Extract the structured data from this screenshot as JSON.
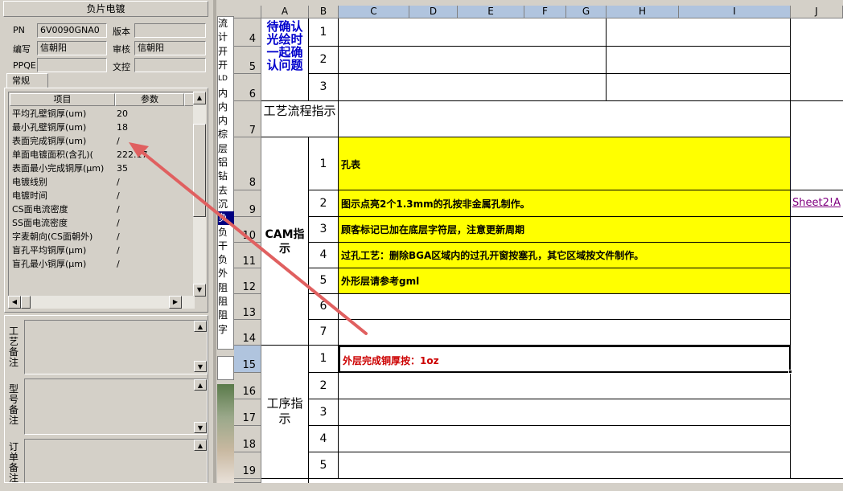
{
  "left_panel": {
    "title": "负片电镀",
    "fields": {
      "pn_label": "PN",
      "pn_value": "6V0090GNA0",
      "version_label": "版本",
      "version_value": "",
      "author_label": "编写",
      "author_value": "信朝阳",
      "reviewer_label": "审核",
      "reviewer_value": "信朝阳",
      "ppqe_label": "PPQE",
      "ppqe_value": "",
      "doc_control_label": "文控",
      "doc_control_value": ""
    },
    "tab": "常规",
    "grid": {
      "headers": [
        "项目",
        "参数"
      ],
      "rows": [
        {
          "item": "平均孔壁铜厚(um)",
          "param": "20"
        },
        {
          "item": "最小孔壁铜厚(um)",
          "param": "18"
        },
        {
          "item": "表面完成铜厚(um)",
          "param": "/"
        },
        {
          "item": "单面电镀面积(含孔)(",
          "param": "222.17"
        },
        {
          "item": "表面最小完成铜厚(μm)",
          "param": "35"
        },
        {
          "item": "电镀线别",
          "param": "/"
        },
        {
          "item": "电镀时间",
          "param": "/"
        },
        {
          "item": "CS面电流密度",
          "param": "/"
        },
        {
          "item": "SS面电流密度",
          "param": "/"
        },
        {
          "item": "字麦朝向(CS面朝外)",
          "param": "/"
        },
        {
          "item": "盲孔平均铜厚(μm)",
          "param": "/"
        },
        {
          "item": "盲孔最小铜厚(μm)",
          "param": "/"
        }
      ]
    },
    "memos": [
      {
        "label": "工艺备注"
      },
      {
        "label": "型号备注"
      },
      {
        "label": "订单备注"
      }
    ]
  },
  "mid_strip_chars": [
    "流",
    "计",
    "开",
    "开",
    "LD",
    "内",
    "内",
    "内",
    "棕",
    "层",
    "铝",
    "钻",
    "去",
    "沉",
    "负",
    "负",
    "干",
    "负",
    "外",
    "阻",
    "阻",
    "阻",
    "字"
  ],
  "spreadsheet": {
    "columns": [
      "A",
      "B",
      "C",
      "D",
      "E",
      "F",
      "G",
      "H",
      "I",
      "J"
    ],
    "rows": {
      "r4": {
        "num": "4",
        "b": "1"
      },
      "r5": {
        "num": "5",
        "b": "2"
      },
      "r6": {
        "num": "6",
        "b": "3"
      },
      "r7": {
        "num": "7"
      },
      "r8": {
        "num": "8",
        "b": "1",
        "c": "孔表"
      },
      "r9": {
        "num": "9",
        "b": "2",
        "c": "图示点亮2个1.3mm的孔按非金属孔制作。",
        "j": "Sheet2!A"
      },
      "r10": {
        "num": "10",
        "b": "3",
        "c": "顾客标记已加在底层字符层，注意更新周期"
      },
      "r11": {
        "num": "11",
        "b": "4",
        "c": "过孔工艺：删除BGA区域内的过孔开窗按塞孔，其它区域按文件制作。"
      },
      "r12": {
        "num": "12",
        "b": "5",
        "c": "外形层请参考gml"
      },
      "r13": {
        "num": "13",
        "b": "6"
      },
      "r14": {
        "num": "14",
        "b": "7"
      },
      "r15": {
        "num": "15",
        "b": "1",
        "c": "外层完成铜厚按：1oz"
      },
      "r16": {
        "num": "16",
        "b": "2"
      },
      "r17": {
        "num": "17",
        "b": "3"
      },
      "r18": {
        "num": "18",
        "b": "4"
      },
      "r19": {
        "num": "19",
        "b": "5"
      }
    },
    "sections": {
      "pending": "待确认光绘时一起确认问题",
      "flow": "工艺流程指示",
      "cam": "CAM指示",
      "process": "工序指示"
    }
  },
  "colors": {
    "highlight": "#ffff00",
    "arrow": "#e06060",
    "red_text": "#cc0000",
    "blue_text": "#0000cc"
  }
}
